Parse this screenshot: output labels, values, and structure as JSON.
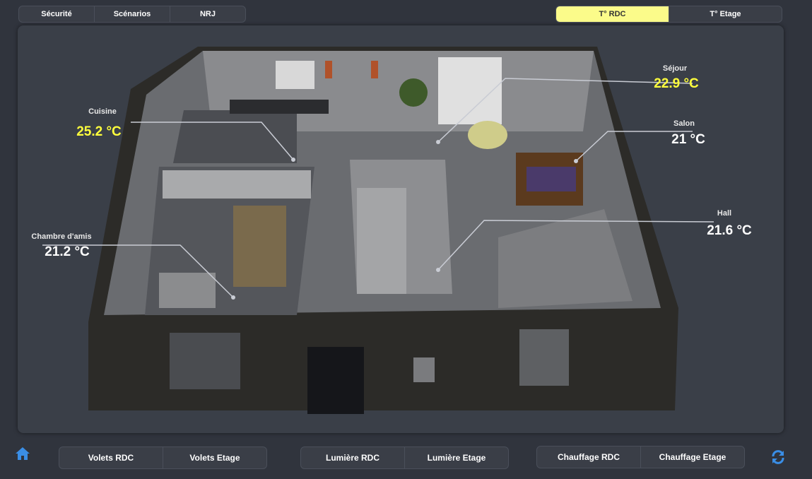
{
  "top_nav": {
    "left_tabs": [
      {
        "label": "Sécurité"
      },
      {
        "label": "Scénarios"
      },
      {
        "label": "NRJ"
      }
    ],
    "right_tabs": [
      {
        "label": "T° RDC",
        "active": true
      },
      {
        "label": "T° Etage",
        "active": false
      }
    ]
  },
  "rooms": {
    "cuisine": {
      "name": "Cuisine",
      "temp": "25.2 °C",
      "status": "hot"
    },
    "sejour": {
      "name": "Séjour",
      "temp": "22.9 °C",
      "status": "hot"
    },
    "salon": {
      "name": "Salon",
      "temp": "21 °C",
      "status": "normal"
    },
    "hall": {
      "name": "Hall",
      "temp": "21.6 °C",
      "status": "normal"
    },
    "chambre": {
      "name": "Chambre d'amis",
      "temp": "21.2 °C",
      "status": "normal"
    }
  },
  "bottom_nav": {
    "volets": [
      {
        "label": "Volets RDC"
      },
      {
        "label": "Volets Etage"
      }
    ],
    "lumiere": [
      {
        "label": "Lumière RDC"
      },
      {
        "label": "Lumière Etage"
      }
    ],
    "chauffage": [
      {
        "label": "Chauffage RDC"
      },
      {
        "label": "Chauffage Etage"
      }
    ]
  },
  "icons": {
    "home": "home-icon",
    "refresh": "refresh-icon"
  },
  "colors": {
    "accent": "#fbfb8a",
    "hot_temp": "#ffff3c",
    "icon_blue": "#3a8ee6",
    "background": "#30343d"
  }
}
